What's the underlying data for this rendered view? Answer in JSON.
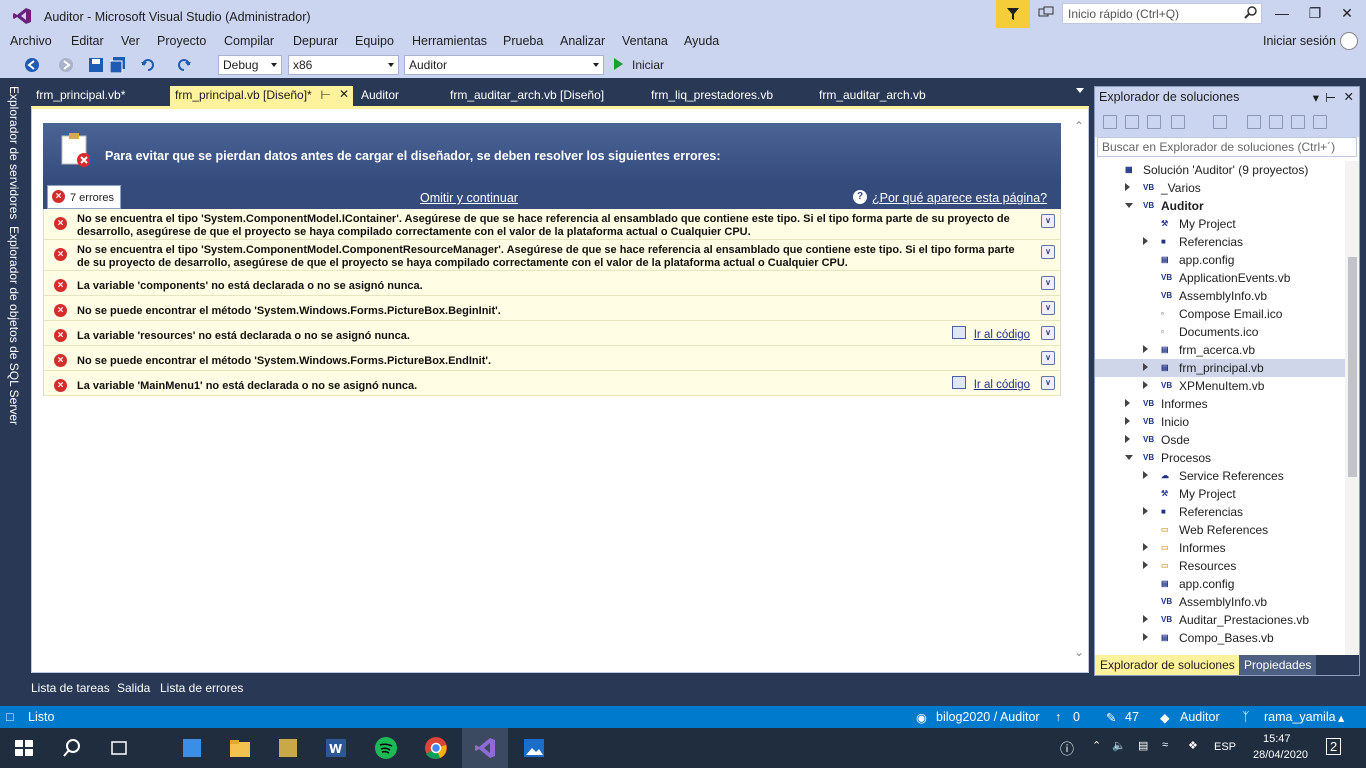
{
  "window": {
    "title": "Auditor - Microsoft Visual Studio  (Administrador)",
    "quick_launch_placeholder": "Inicio rápido (Ctrl+Q)"
  },
  "menu": [
    "Archivo",
    "Editar",
    "Ver",
    "Proyecto",
    "Compilar",
    "Depurar",
    "Equipo",
    "Herramientas",
    "Prueba",
    "Analizar",
    "Ventana",
    "Ayuda"
  ],
  "login": "Iniciar sesión",
  "toolbar": {
    "config": "Debug",
    "platform": "x86",
    "project": "Auditor",
    "start": "Iniciar"
  },
  "left_tabs": [
    "Explorador de servidores",
    "Explorador de objetos de SQL Server"
  ],
  "doc_tabs": [
    "frm_principal.vb*",
    "frm_principal.vb [Diseño]*",
    "Auditor",
    "frm_auditar_arch.vb [Diseño]",
    "frm_liq_prestadores.vb",
    "frm_auditar_arch.vb"
  ],
  "designer": {
    "header": "Para evitar que se pierdan datos antes de cargar el diseñador, se deben resolver los siguientes errores:",
    "count": "7 errores",
    "omit": "Omitir y continuar",
    "why": "¿Por qué aparece esta página?",
    "goto": "Ir al código",
    "errors": [
      "No se encuentra el tipo 'System.ComponentModel.IContainer'. Asegúrese de que se hace referencia al ensamblado que contiene este tipo. Si el tipo forma parte de su proyecto de desarrollo, asegúrese de que el proyecto se haya compilado correctamente con el valor de la plataforma actual o Cualquier CPU.",
      "No se encuentra el tipo 'System.ComponentModel.ComponentResourceManager'. Asegúrese de que se hace referencia al ensamblado que contiene este tipo. Si el tipo forma parte de su proyecto de desarrollo, asegúrese de que el proyecto se haya compilado correctamente con el valor de la plataforma actual o Cualquier CPU.",
      "La variable 'components' no está declarada o no se asignó nunca.",
      "No se puede encontrar el método 'System.Windows.Forms.PictureBox.BeginInit'.",
      "La variable 'resources' no está declarada o no se asignó nunca.",
      "No se puede encontrar el método 'System.Windows.Forms.PictureBox.EndInit'.",
      "La variable 'MainMenu1' no está declarada o no se asignó nunca."
    ]
  },
  "solution_explorer": {
    "title": "Explorador de soluciones",
    "search": "Buscar en Explorador de soluciones (Ctrl+´)",
    "nodes": [
      {
        "label": "Solución 'Auditor'  (9 proyectos)",
        "depth": 0,
        "icon": "solution-icon"
      },
      {
        "label": "_Varios",
        "depth": 1,
        "icon": "vb-project-icon"
      },
      {
        "label": "Auditor",
        "depth": 1,
        "icon": "vb-project-icon"
      },
      {
        "label": "My Project",
        "depth": 2,
        "icon": "wrench-icon"
      },
      {
        "label": "Referencias",
        "depth": 2,
        "icon": "references-icon"
      },
      {
        "label": "app.config",
        "depth": 2,
        "icon": "config-icon"
      },
      {
        "label": "ApplicationEvents.vb",
        "depth": 2,
        "icon": "vb-file-icon"
      },
      {
        "label": "AssemblyInfo.vb",
        "depth": 2,
        "icon": "vb-file-icon"
      },
      {
        "label": "Compose Email.ico",
        "depth": 2,
        "icon": "ico-file-icon"
      },
      {
        "label": "Documents.ico",
        "depth": 2,
        "icon": "ico-file-icon"
      },
      {
        "label": "frm_acerca.vb",
        "depth": 2,
        "icon": "form-icon"
      },
      {
        "label": "frm_principal.vb",
        "depth": 2,
        "icon": "form-icon"
      },
      {
        "label": "XPMenuItem.vb",
        "depth": 2,
        "icon": "vb-file-icon"
      },
      {
        "label": "Informes",
        "depth": 1,
        "icon": "vb-project-icon"
      },
      {
        "label": "Inicio",
        "depth": 1,
        "icon": "vb-project-icon"
      },
      {
        "label": "Osde",
        "depth": 1,
        "icon": "vb-project-icon"
      },
      {
        "label": "Procesos",
        "depth": 1,
        "icon": "vb-project-icon"
      },
      {
        "label": "Service References",
        "depth": 2,
        "icon": "service-icon"
      },
      {
        "label": "My Project",
        "depth": 2,
        "icon": "wrench-icon"
      },
      {
        "label": "Referencias",
        "depth": 2,
        "icon": "references-icon"
      },
      {
        "label": "Web References",
        "depth": 2,
        "icon": "folder-icon"
      },
      {
        "label": "Informes",
        "depth": 2,
        "icon": "folder-icon"
      },
      {
        "label": "Resources",
        "depth": 2,
        "icon": "folder-icon"
      },
      {
        "label": "app.config",
        "depth": 2,
        "icon": "config-icon"
      },
      {
        "label": "AssemblyInfo.vb",
        "depth": 2,
        "icon": "vb-file-icon"
      },
      {
        "label": "Auditar_Prestaciones.vb",
        "depth": 2,
        "icon": "vb-file-icon"
      },
      {
        "label": "Compo_Bases.vb",
        "depth": 2,
        "icon": "form-icon"
      }
    ],
    "tabs": [
      "Explorador de soluciones",
      "Propiedades"
    ]
  },
  "bottom_tabs": [
    "Lista de tareas",
    "Salida",
    "Lista de errores"
  ],
  "status": {
    "ready": "Listo",
    "repo": "bilog2020 / Auditor",
    "up": "0",
    "changes": "47",
    "branch_repo": "Auditor",
    "branch": "rama_yamila"
  },
  "taskbar": {
    "lang": "ESP",
    "time": "15:47",
    "date": "28/04/2020",
    "notifications": "2"
  }
}
